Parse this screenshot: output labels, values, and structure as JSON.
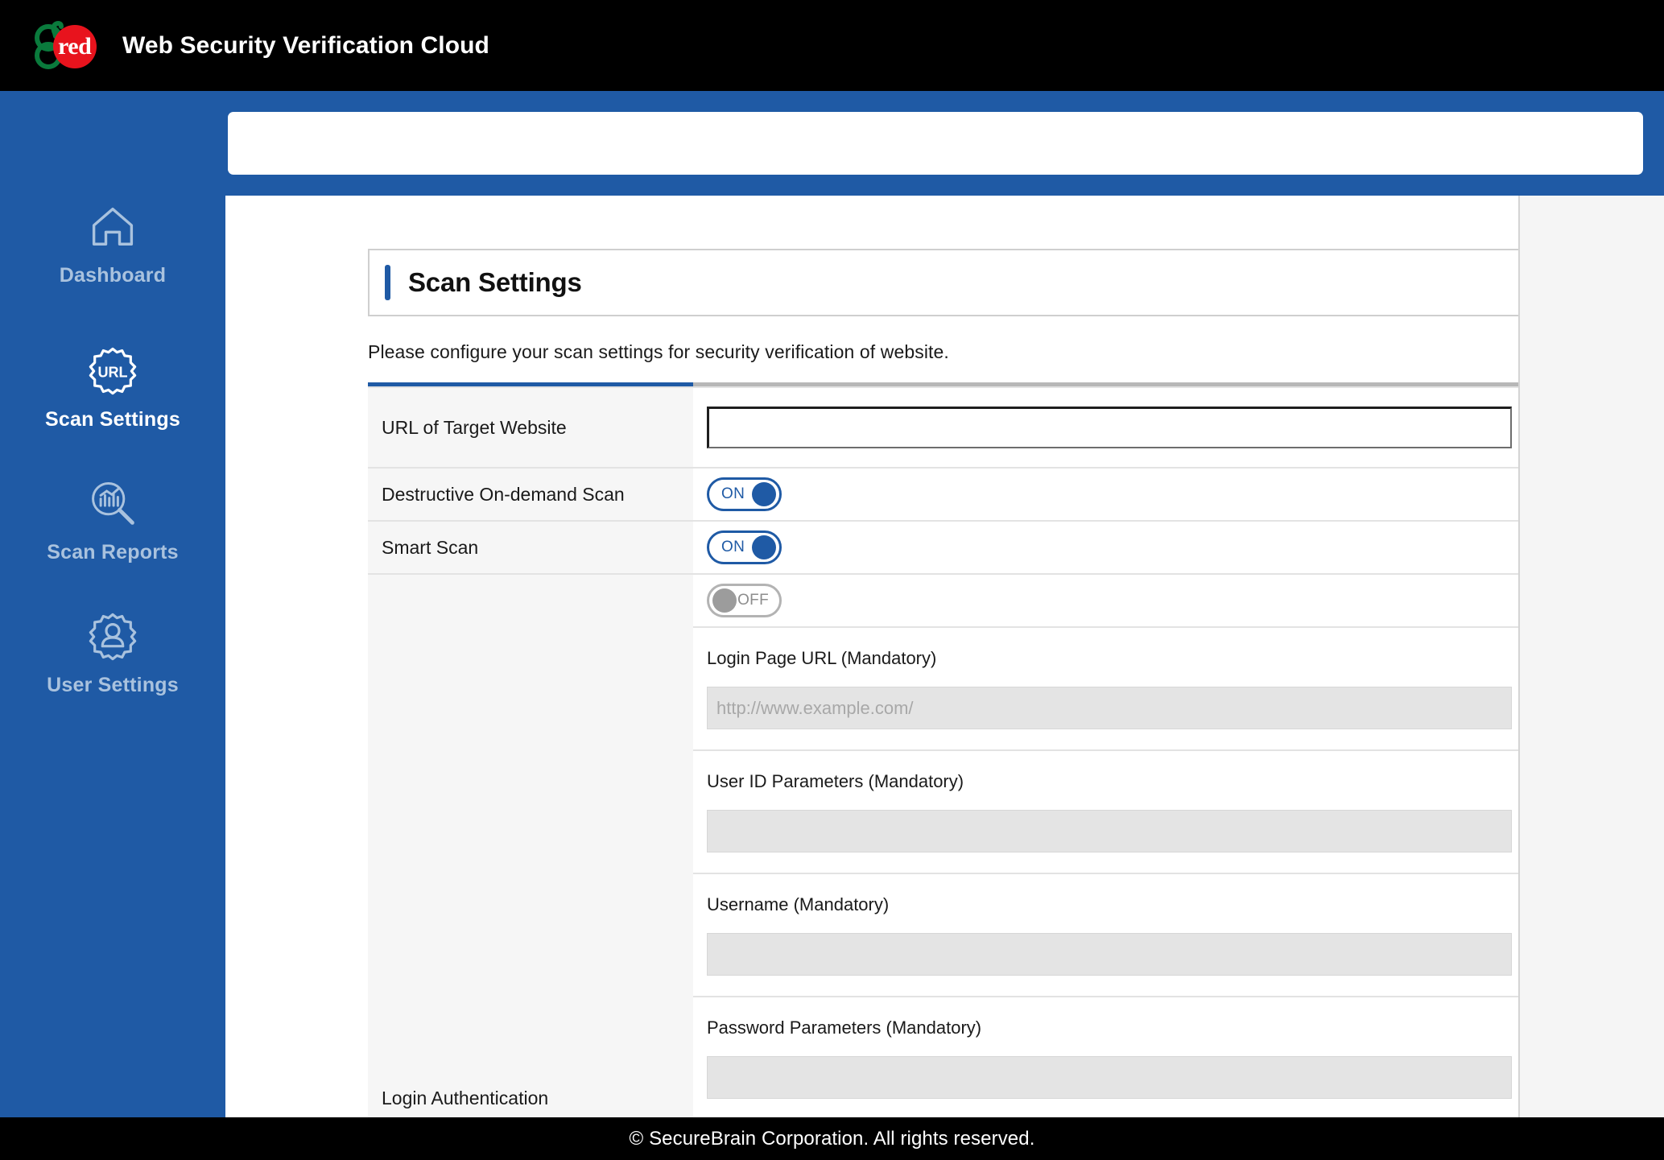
{
  "header": {
    "app_title": "Web Security Verification Cloud",
    "logo_text": "red",
    "logo_icon": "gred-logo-icon"
  },
  "sidebar": {
    "items": [
      {
        "label": "Dashboard",
        "icon": "home-icon",
        "active": false
      },
      {
        "label": "Scan Settings",
        "icon": "url-gear-icon",
        "active": true
      },
      {
        "label": "Scan Reports",
        "icon": "chart-magnifier-icon",
        "active": false
      },
      {
        "label": "User Settings",
        "icon": "user-gear-icon",
        "active": false
      }
    ]
  },
  "main": {
    "page_title": "Scan Settings",
    "description": "Please configure your scan settings for security verification of website.",
    "rows": {
      "url_target": {
        "label": "URL of Target Website",
        "value": "",
        "placeholder": ""
      },
      "destructive_scan": {
        "label": "Destructive On-demand Scan",
        "toggle_state": "ON"
      },
      "smart_scan": {
        "label": "Smart Scan",
        "toggle_state": "ON"
      },
      "login_auth": {
        "label": "Login Authentication",
        "toggle_state": "OFF",
        "fields": [
          {
            "label": "Login Page URL (Mandatory)",
            "value": "",
            "placeholder": "http://www.example.com/",
            "disabled": true
          },
          {
            "label": "User ID Parameters (Mandatory)",
            "value": "",
            "placeholder": "",
            "disabled": true
          },
          {
            "label": "Username (Mandatory)",
            "value": "",
            "placeholder": "",
            "disabled": true
          },
          {
            "label": "Password Parameters (Mandatory)",
            "value": "",
            "placeholder": "",
            "disabled": true
          }
        ]
      }
    }
  },
  "footer": {
    "copyright": "© SecureBrain Corporation. All rights reserved."
  },
  "colors": {
    "brand_blue": "#1f5aa5",
    "brand_red": "#e8131d",
    "header_black": "#000000",
    "sidebar_inactive_text": "#a9c2de",
    "label_col_bg": "#f6f6f6",
    "disabled_field_bg": "#e4e4e4"
  }
}
